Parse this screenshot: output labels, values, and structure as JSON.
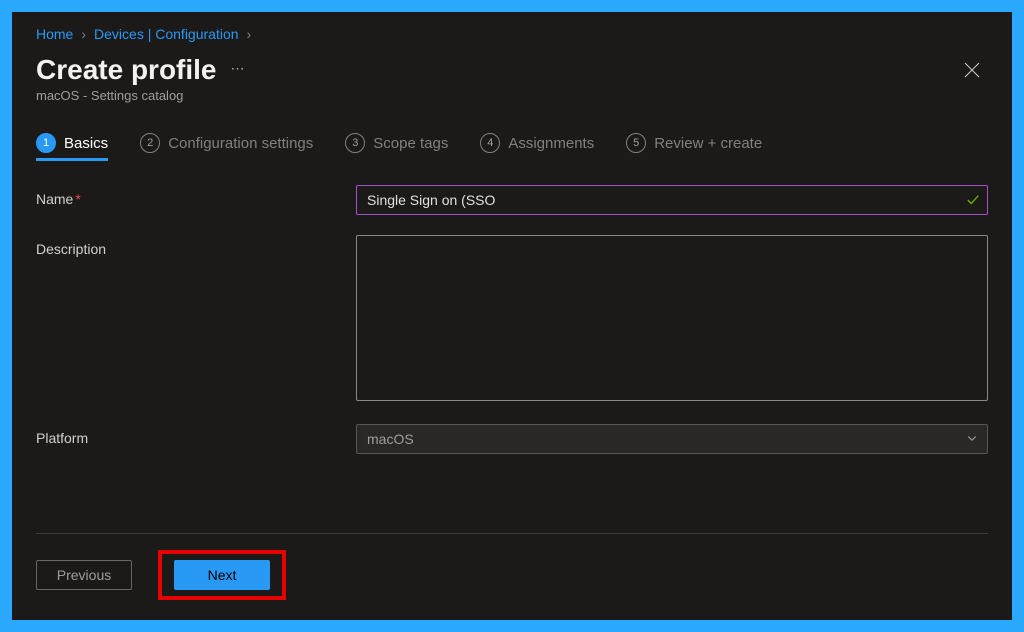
{
  "breadcrumb": {
    "home": "Home",
    "devices": "Devices | Configuration"
  },
  "header": {
    "title": "Create profile",
    "subtitle": "macOS - Settings catalog"
  },
  "stepper": {
    "steps": [
      {
        "num": "1",
        "label": "Basics"
      },
      {
        "num": "2",
        "label": "Configuration settings"
      },
      {
        "num": "3",
        "label": "Scope tags"
      },
      {
        "num": "4",
        "label": "Assignments"
      },
      {
        "num": "5",
        "label": "Review + create"
      }
    ],
    "active_index": 0
  },
  "form": {
    "name_label": "Name",
    "name_value": "Single Sign on (SSO",
    "description_label": "Description",
    "description_value": "",
    "platform_label": "Platform",
    "platform_value": "macOS"
  },
  "footer": {
    "previous": "Previous",
    "next": "Next"
  }
}
